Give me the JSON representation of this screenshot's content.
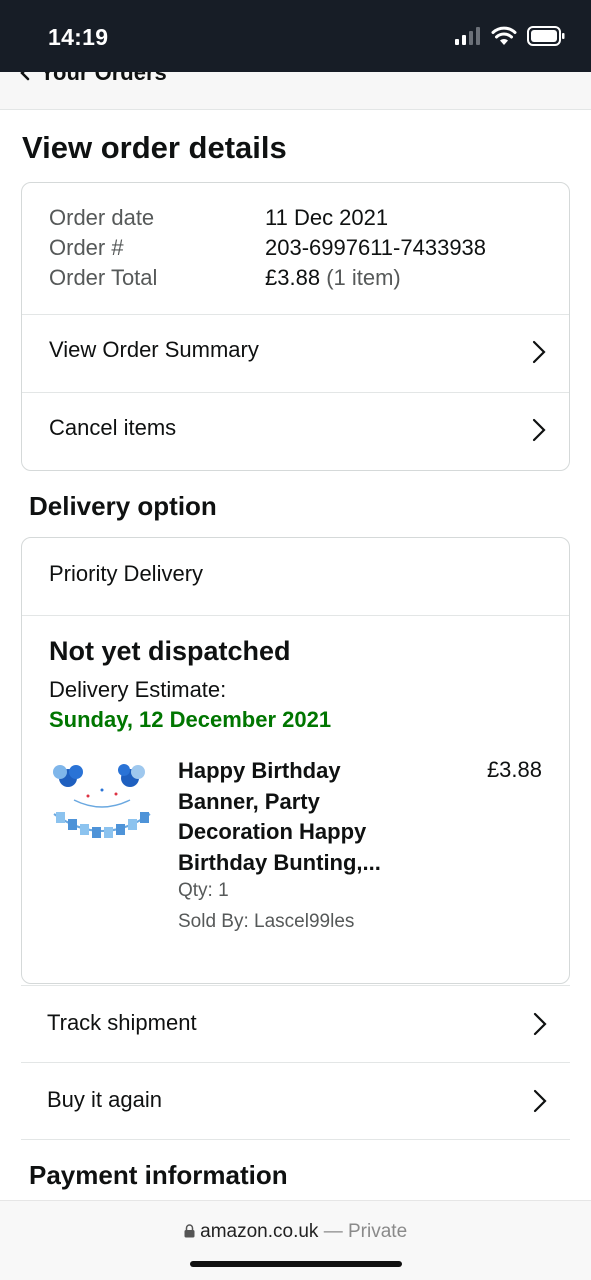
{
  "status_bar": {
    "time": "14:19"
  },
  "nav": {
    "back_label": "Your Orders"
  },
  "page_title": "View order details",
  "order": {
    "date_label": "Order date",
    "date_value": "11 Dec 2021",
    "number_label": "Order #",
    "number_value": "203-6997611-7433938",
    "total_label": "Order Total",
    "total_value": "£3.88",
    "total_items": "(1 item)",
    "view_summary": "View Order Summary",
    "cancel_items": "Cancel items"
  },
  "delivery": {
    "section_title": "Delivery option",
    "option": "Priority Delivery",
    "status": "Not yet dispatched",
    "estimate_label": "Delivery Estimate:",
    "estimate_date": "Sunday, 12 December 2021",
    "product": {
      "title": "Happy Birthday Banner, Party Decoration Happy Birthday Bunting,...",
      "price": "£3.88",
      "qty": "Qty: 1",
      "seller": "Sold By: Lascel99les"
    }
  },
  "actions": {
    "track": "Track shipment",
    "buy_again": "Buy it again"
  },
  "payment": {
    "section_title": "Payment information"
  },
  "browser": {
    "domain": "amazon.co.uk",
    "private": "— Private"
  },
  "icons": [
    "signal-icon",
    "wifi-icon",
    "battery-icon",
    "back-chevron-icon",
    "chevron-right-icon",
    "lock-icon"
  ],
  "colors": {
    "status_bar_bg": "#171d26",
    "estimate_green": "#007600",
    "border": "#d5d9d9"
  }
}
